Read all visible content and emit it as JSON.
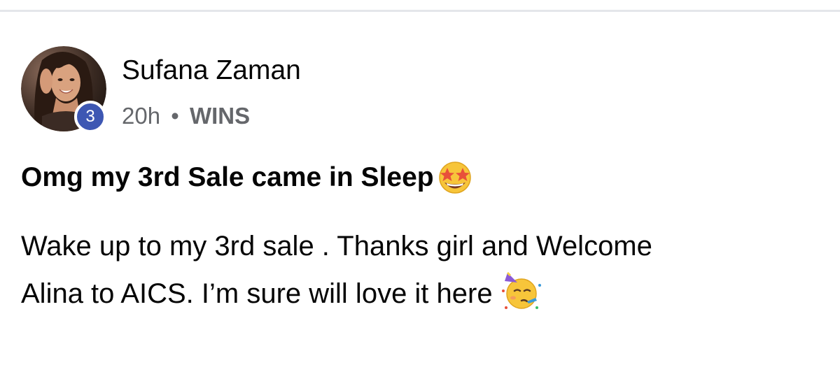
{
  "post": {
    "author": {
      "name": "Sufana Zaman",
      "badge_count": "3"
    },
    "meta": {
      "time": "20h",
      "separator": "•",
      "category": "WINS"
    },
    "title": "Omg my 3rd Sale came in Sleep",
    "title_emoji": "star-struck-emoji",
    "body": {
      "line1": "Wake up to my 3rd sale . Thanks girl and Welcome",
      "line2": "Alina to AICS. I’m sure will love it here",
      "line2_emoji": "partying-face-emoji"
    }
  },
  "colors": {
    "text_primary": "#050505",
    "text_secondary": "#65676b",
    "badge": "#3d57b3",
    "divider": "#e4e6ea"
  }
}
